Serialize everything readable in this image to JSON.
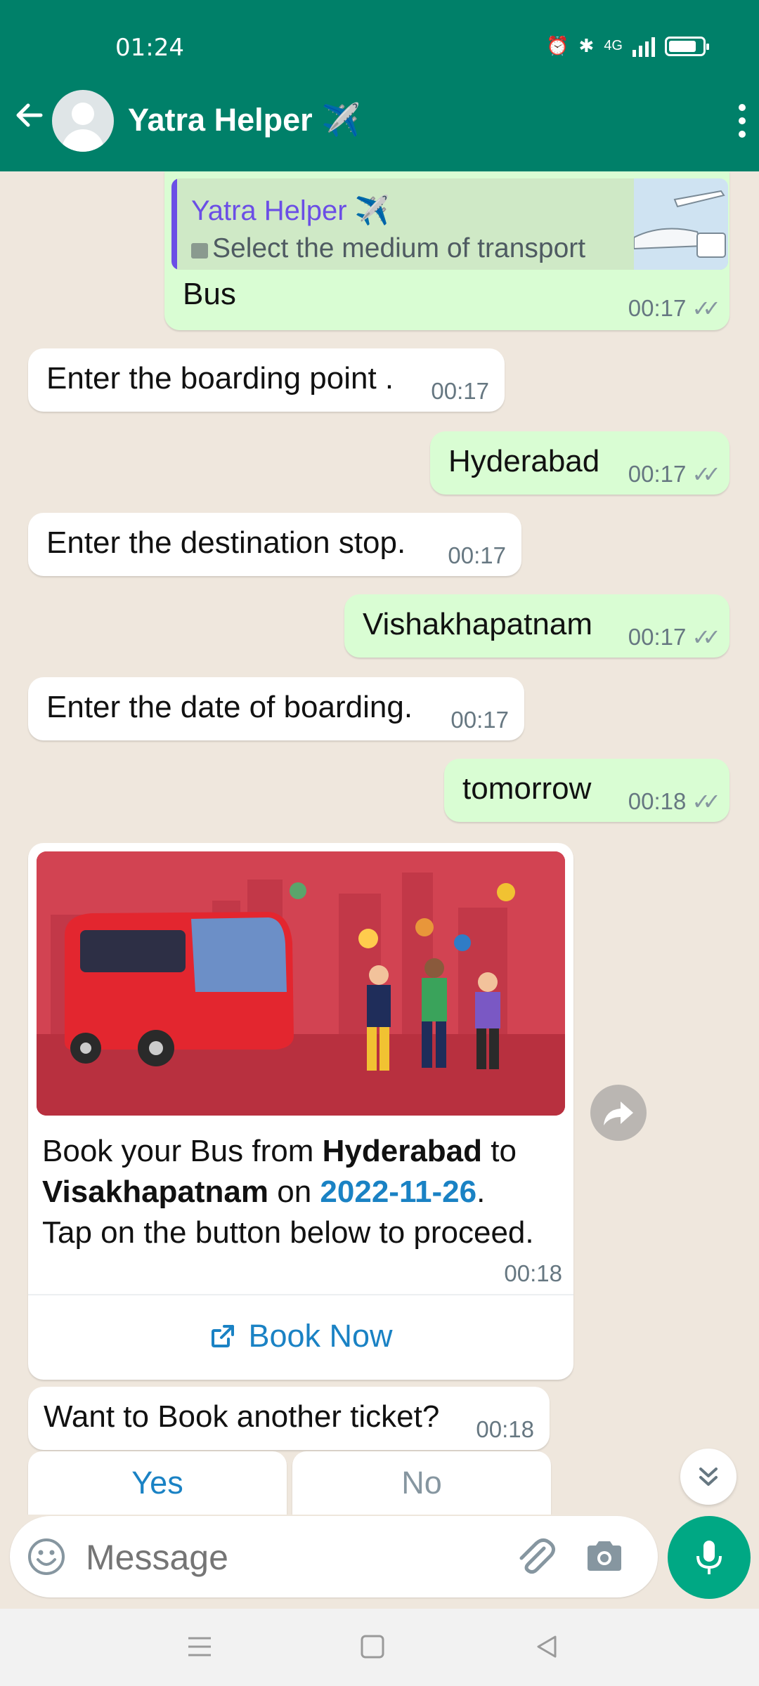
{
  "status_bar": {
    "time": "01:24",
    "network": "4G"
  },
  "header": {
    "title": "Yatra Helper ✈️"
  },
  "messages": [
    {
      "dir": "out",
      "quote_name": "Yatra Helper ✈️",
      "quote_text": "Select the medium of transport",
      "text": "Bus",
      "time": "00:17"
    },
    {
      "dir": "in",
      "text": "Enter the boarding point .",
      "time": "00:17"
    },
    {
      "dir": "out",
      "text": "Hyderabad",
      "time": "00:17"
    },
    {
      "dir": "in",
      "text": "Enter the destination stop.",
      "time": "00:17"
    },
    {
      "dir": "out",
      "text": "Vishakhapatnam",
      "time": "00:17"
    },
    {
      "dir": "in",
      "text": "Enter the date of boarding.",
      "time": "00:17"
    },
    {
      "dir": "out",
      "text": "tomorrow",
      "time": "00:18"
    }
  ],
  "booking_card": {
    "line1_pre": "Book your Bus from ",
    "from": "Hyderabad",
    "line1_mid": " to",
    "to": "Visakhapatnam",
    "on_word": " on ",
    "date": "2022-11-26",
    "period": ".",
    "line3": "Tap on the button below to proceed.",
    "time": "00:18",
    "button_label": "Book Now"
  },
  "prompt": {
    "text": "Want to Book another ticket?",
    "time": "00:18"
  },
  "quick_replies": {
    "yes": "Yes",
    "no": "No"
  },
  "composer": {
    "placeholder": "Message"
  },
  "colors": {
    "header": "#008069",
    "outgoing": "#d9fdd3",
    "link": "#1a82c4",
    "accent": "#00a884"
  }
}
